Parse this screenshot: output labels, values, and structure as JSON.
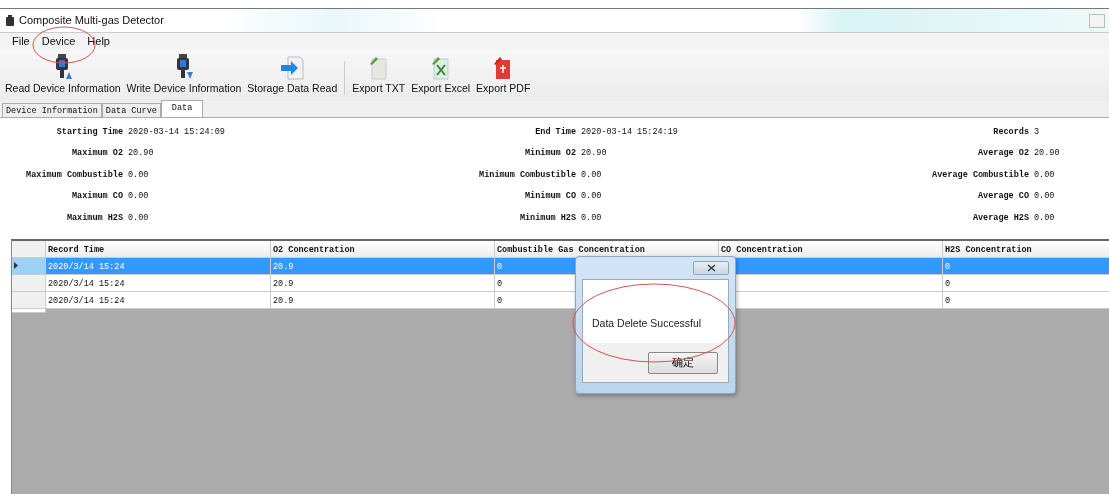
{
  "window": {
    "title": "Composite Multi-gas Detector"
  },
  "menu": [
    {
      "label": "File"
    },
    {
      "label": "Device"
    },
    {
      "label": "Help"
    }
  ],
  "toolbar": [
    {
      "label": "Read Device Information",
      "kind": "usb-read",
      "separator_before": false
    },
    {
      "label": "Write Device Information",
      "kind": "usb-write",
      "separator_before": false
    },
    {
      "label": "Storage Data Read",
      "kind": "storage",
      "separator_before": false
    },
    {
      "label": "Export TXT",
      "kind": "txt",
      "separator_before": true
    },
    {
      "label": "Export Excel",
      "kind": "excel",
      "separator_before": false
    },
    {
      "label": "Export PDF",
      "kind": "pdf",
      "separator_before": false
    }
  ],
  "tabs": [
    {
      "label": "Device Information",
      "selected": false
    },
    {
      "label": "Data Curve",
      "selected": false
    },
    {
      "label": "Data",
      "selected": true
    }
  ],
  "summary": [
    [
      {
        "label": "Starting Time",
        "value": "2020-03-14 15:24:09"
      },
      {
        "label": "End Time",
        "value": "2020-03-14 15:24:19"
      },
      {
        "label": "Records",
        "value": "3"
      }
    ],
    [
      {
        "label": "Maximum O2",
        "value": "20.90"
      },
      {
        "label": "Minimum O2",
        "value": "20.90"
      },
      {
        "label": "Average O2",
        "value": "20.90"
      }
    ],
    [
      {
        "label": "Maximum Combustible",
        "value": "0.00"
      },
      {
        "label": "Minimum Combustible",
        "value": "0.00"
      },
      {
        "label": "Average Combustible",
        "value": "0.00"
      }
    ],
    [
      {
        "label": "Maximum CO",
        "value": "0.00"
      },
      {
        "label": "Minimum CO",
        "value": "0.00"
      },
      {
        "label": "Average CO",
        "value": "0.00"
      }
    ],
    [
      {
        "label": "Maximum H2S",
        "value": "0.00"
      },
      {
        "label": "Minimum H2S",
        "value": "0.00"
      },
      {
        "label": "Average H2S",
        "value": "0.00"
      }
    ]
  ],
  "table": {
    "columns": [
      "Record Time",
      "O2 Concentration",
      "Combustible Gas Concentration",
      "CO Concentration",
      "H2S Concentration"
    ],
    "rows": [
      {
        "selected": true,
        "record_time": "2020/3/14 15:24",
        "o2": "20.9",
        "combustible": "0",
        "h2s": "0"
      },
      {
        "selected": false,
        "record_time": "2020/3/14 15:24",
        "o2": "20.9",
        "combustible": "0",
        "h2s": "0"
      },
      {
        "selected": false,
        "record_time": "2020/3/14 15:24",
        "o2": "20.9",
        "combustible": "0",
        "h2s": "0"
      }
    ]
  },
  "dialog": {
    "message": "Data Delete Successful",
    "button": "确定"
  }
}
